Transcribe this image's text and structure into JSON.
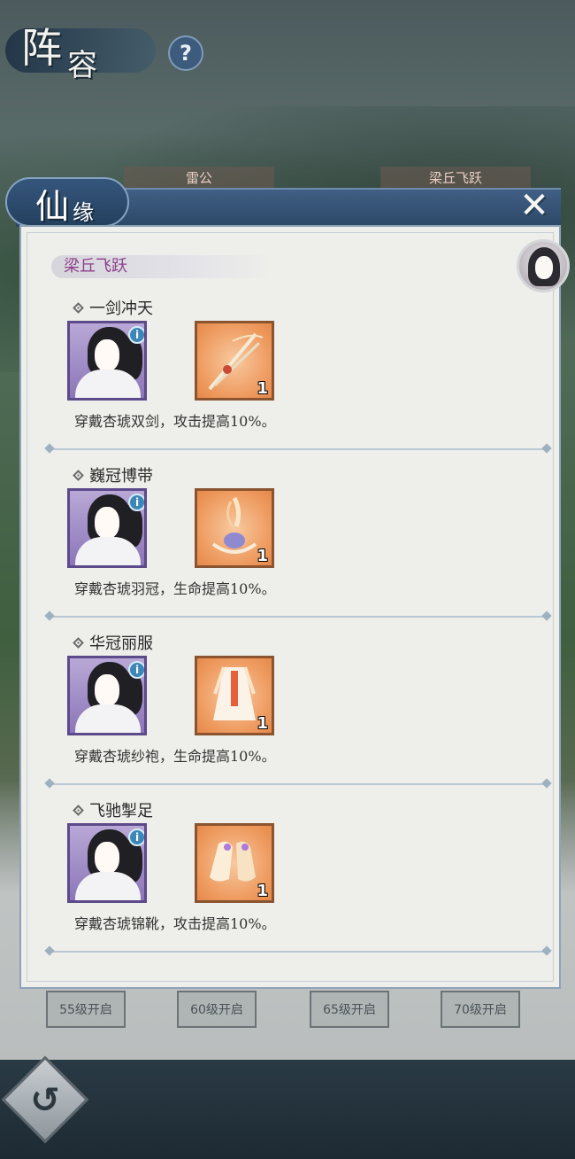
{
  "page": {
    "title_big": "阵",
    "title_small": "容",
    "help_label": "?",
    "tabs": [
      "雷公",
      "梁丘飞跃"
    ],
    "level_slots": [
      "55级开启",
      "60级开启",
      "65级开启",
      "70级开启"
    ],
    "back_label": "↺"
  },
  "dialog": {
    "title_big": "仙",
    "title_small": "缘",
    "close_label": "✕",
    "banner": "梁丘飞跃",
    "entries": [
      {
        "title": "一剑冲天",
        "item_count": "1",
        "desc": "穿戴杏琥双剑，攻击提高10%。"
      },
      {
        "title": "巍冠博带",
        "item_count": "1",
        "desc": "穿戴杏琥羽冠，生命提高10%。"
      },
      {
        "title": "华冠丽服",
        "item_count": "1",
        "desc": "穿戴杏琥纱袍，生命提高10%。"
      },
      {
        "title": "飞驰掣足",
        "item_count": "1",
        "desc": "穿戴杏琥锦靴，攻击提高10%。"
      }
    ],
    "info_badge": "i"
  },
  "colors": {
    "banner_text": "#8c3e8a",
    "header_blue": "#2c4868",
    "item_bg": "#ee9a5e",
    "portrait_bg": "#8c76b8"
  }
}
